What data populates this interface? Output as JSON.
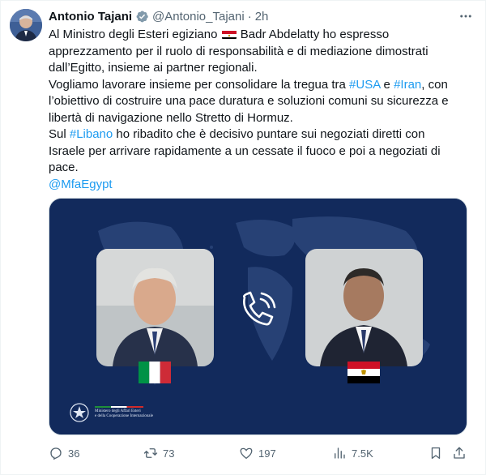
{
  "tweet": {
    "author_name": "Antonio Tajani",
    "handle": "@Antonio_Tajani",
    "separator": "·",
    "time": "2h",
    "text": {
      "l1a": "Al Ministro degli Esteri egiziano ",
      "l1b": " Badr Abdelatty ho espresso",
      "l2": "apprezzamento per il ruolo di responsabilità e di mediazione dimostrati",
      "l3": "dall’Egitto, insieme ai partner regionali.",
      "l4a": "Vogliamo lavorare insieme per consolidare la tregua tra ",
      "l4_usa": "#USA",
      "l4b": " e ",
      "l4_iran": "#Iran",
      "l4c": ", con",
      "l5": "l’obiettivo di costruire una pace duratura e soluzioni comuni su sicurezza e",
      "l6": "libertà di navigazione nello Stretto di Hormuz.",
      "l7a": "Sul ",
      "l7_libano": "#Libano",
      "l7b": " ho ribadito che è decisivo puntare sui negoziati diretti con",
      "l8": "Israele per arrivare rapidamente a un cessate il fuoco e poi a negoziati di",
      "l9": "pace.",
      "mention": "@MfaEgypt"
    },
    "media": {
      "ministry_line1": "Ministero degli Affari Esteri",
      "ministry_line2": "e della Cooperazione Internazionale"
    },
    "stats": {
      "replies": "36",
      "retweets": "73",
      "likes": "197",
      "views": "7.5K"
    },
    "icons": [
      "verified-badge-icon",
      "more-icon",
      "reply-icon",
      "retweet-icon",
      "like-icon",
      "views-icon",
      "bookmark-icon",
      "share-icon",
      "phone-call-icon"
    ],
    "colors": {
      "link": "#1d9bf0",
      "verified": "#829aab",
      "media_background": "#122a5c",
      "secondary_text": "#536471"
    }
  }
}
